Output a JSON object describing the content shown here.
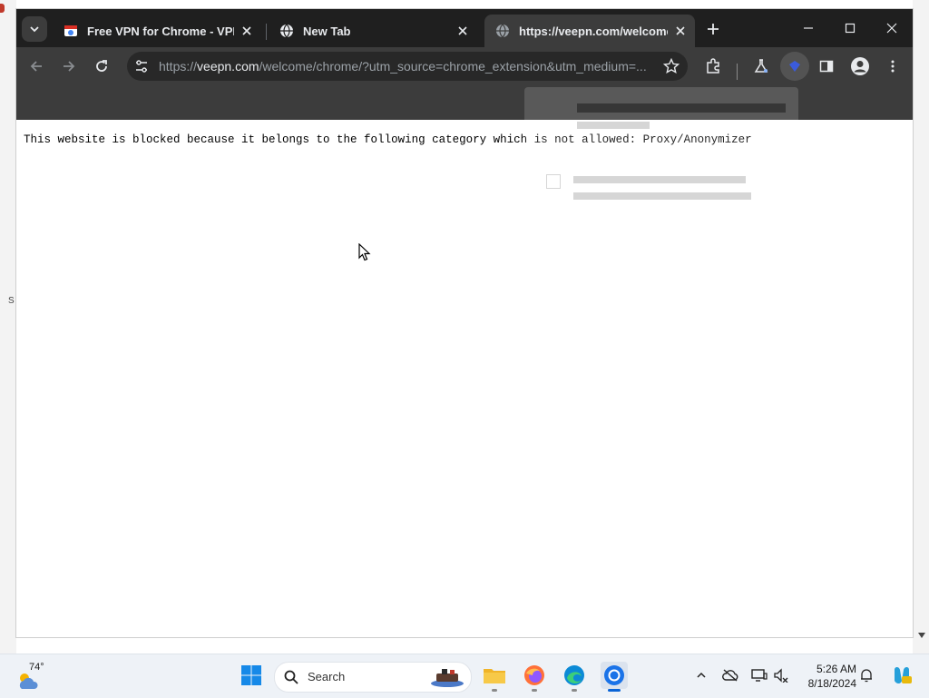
{
  "tabs": [
    {
      "title": "Free VPN for Chrome - VPN Pr",
      "icon": "vpn-store-icon",
      "active": false
    },
    {
      "title": "New Tab",
      "icon": "globe-icon",
      "active": false
    },
    {
      "title": "https://veepn.com/welcome/c",
      "icon": "globe-icon",
      "active": true
    }
  ],
  "omnibox": {
    "url_prefix": "https://",
    "url_host": "veepn.com",
    "url_path": "/welcome/chrome/?utm_source=chrome_extension&utm_medium=..."
  },
  "page": {
    "blocked_message": "This website is blocked because it belongs to the following category which is not allowed: Proxy/Anonymizer"
  },
  "taskbar": {
    "temperature": "74°",
    "search_label": "Search",
    "time": "5:26 AM",
    "date": "8/18/2024"
  },
  "desktop": {
    "edge_char": "S"
  },
  "colors": {
    "tabstrip": "#1f1f1f",
    "toolbar": "#3c3c3c",
    "omnibox": "#282828",
    "taskbar": "#eef2f7",
    "accent": "#0a64d6"
  }
}
